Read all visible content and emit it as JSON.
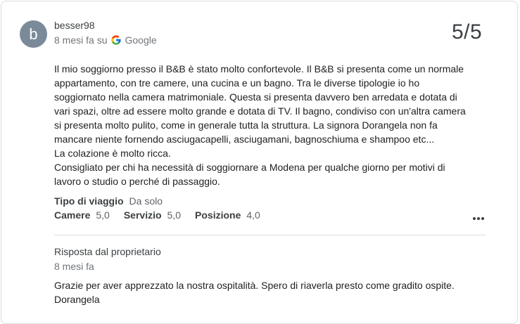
{
  "reviewer": {
    "avatar_letter": "b",
    "avatar_color": "#7a8a99",
    "name": "besser98",
    "time_prefix": "8 mesi fa su",
    "source_icon": "google-g-icon",
    "source": "Google"
  },
  "score": "5/5",
  "review_lines": [
    "Il mio soggiorno presso il B&B è stato molto confortevole. Il B&B si presenta come un normale",
    "appartamento, con tre camere, una cucina e un bagno. Tra le diverse tipologie io ho",
    "soggiornato nella camera matrimoniale. Questa si presenta davvero ben arredata e dotata di",
    "vari spazi, oltre ad essere molto grande e dotata di TV. Il bagno, condiviso con un'altra camera",
    "si presenta molto pulito, come in generale tutta la struttura. La signora Dorangela non fa",
    "mancare niente fornendo asciugacapelli, asciugamani, bagnoschiuma e shampoo etc...",
    "La colazione è molto ricca.",
    "Consigliato per chi ha necessità di soggiornare a Modena per qualche giorno per motivi di",
    "lavoro o studio o perché di passaggio."
  ],
  "trip": {
    "label": "Tipo di viaggio",
    "value": "Da solo"
  },
  "ratings": [
    {
      "label": "Camere",
      "value": "5,0"
    },
    {
      "label": "Servizio",
      "value": "5,0"
    },
    {
      "label": "Posizione",
      "value": "4,0"
    }
  ],
  "more_icon": "more-horizontal-icon",
  "owner": {
    "label": "Risposta dal proprietario",
    "time": "8 mesi fa",
    "reply_lines": [
      "Grazie per aver apprezzato la nostra ospitalità. Spero di riaverla presto come gradito ospite.",
      "Dorangela"
    ]
  }
}
